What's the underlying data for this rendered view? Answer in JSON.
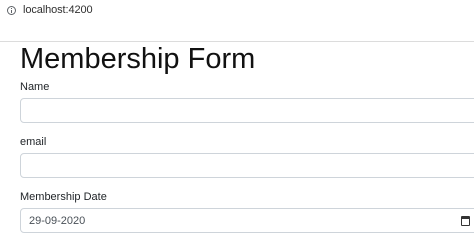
{
  "browser": {
    "url": "localhost:4200"
  },
  "form": {
    "title": "Membership Form",
    "fields": [
      {
        "label": "Name",
        "value": ""
      },
      {
        "label": "email",
        "value": ""
      },
      {
        "label": "Membership Date",
        "value": "29-09-2020"
      }
    ]
  },
  "icons": {
    "site_info": "info-icon",
    "date_picker": "calendar-icon"
  }
}
